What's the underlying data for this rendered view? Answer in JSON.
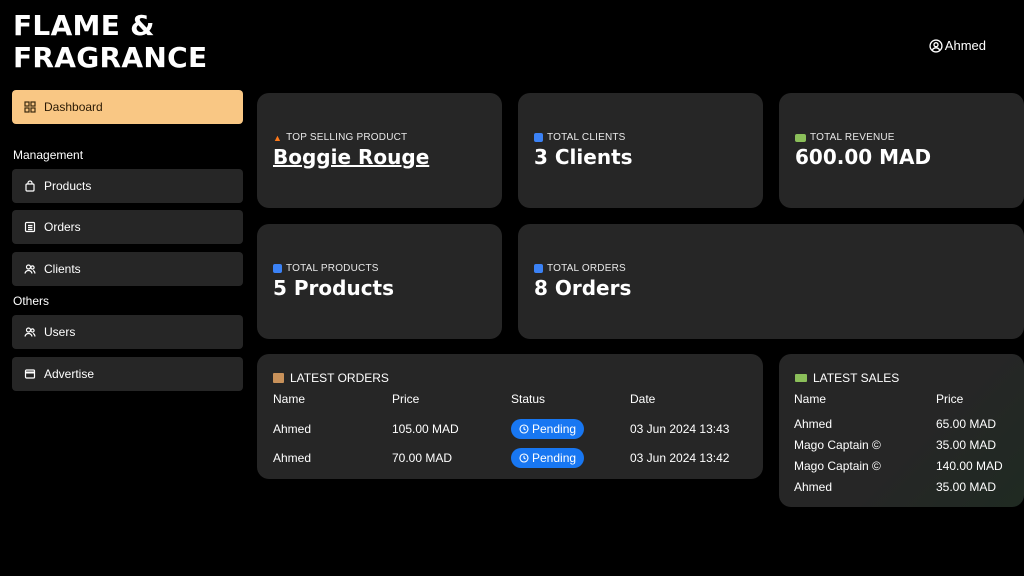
{
  "brand": {
    "line1": "FLAME &",
    "line2": "FRAGRANCE"
  },
  "user": {
    "name": "Ahmed"
  },
  "sidebar": {
    "dashboard": "Dashboard",
    "management_label": "Management",
    "management": [
      "Products",
      "Orders",
      "Clients"
    ],
    "others_label": "Others",
    "others": [
      "Users",
      "Advertise"
    ]
  },
  "stats": {
    "top_product": {
      "label": "TOP SELLING PRODUCT",
      "value": "Boggie Rouge"
    },
    "clients": {
      "label": "TOTAL CLIENTS",
      "value": "3 Clients"
    },
    "revenue": {
      "label": "TOTAL REVENUE",
      "value": "600.00 MAD"
    },
    "products": {
      "label": "TOTAL PRODUCTS",
      "value": "5 Products"
    },
    "orders": {
      "label": "TOTAL ORDERS",
      "value": "8 Orders"
    }
  },
  "latest_orders": {
    "title": "LATEST ORDERS",
    "headers": {
      "name": "Name",
      "price": "Price",
      "status": "Status",
      "date": "Date"
    },
    "rows": [
      {
        "name": "Ahmed",
        "price": "105.00 MAD",
        "status": "Pending",
        "date": "03 Jun 2024 13:43"
      },
      {
        "name": "Ahmed",
        "price": "70.00 MAD",
        "status": "Pending",
        "date": "03 Jun 2024 13:42"
      }
    ]
  },
  "latest_sales": {
    "title": "LATEST SALES",
    "headers": {
      "name": "Name",
      "price": "Price"
    },
    "rows": [
      {
        "name": "Ahmed",
        "price": "65.00 MAD"
      },
      {
        "name": "Mago Captain ©",
        "price": "35.00 MAD"
      },
      {
        "name": "Mago Captain ©",
        "price": "140.00 MAD"
      },
      {
        "name": "Ahmed",
        "price": "35.00 MAD"
      }
    ]
  },
  "colors": {
    "accent": "#f9c784",
    "card": "#262626",
    "badge": "#1877f2",
    "background": "#000000"
  }
}
